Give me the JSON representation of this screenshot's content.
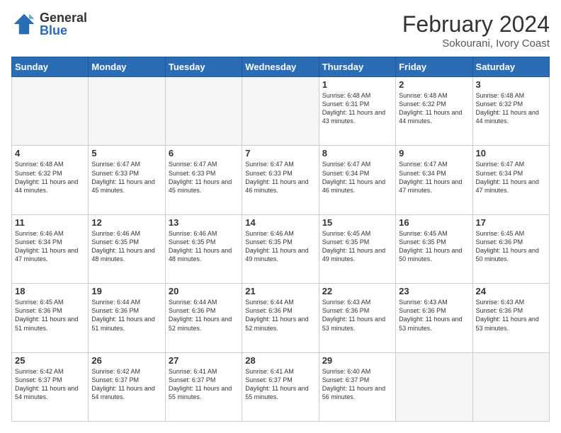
{
  "header": {
    "logo_general": "General",
    "logo_blue": "Blue",
    "month_year": "February 2024",
    "location": "Sokourani, Ivory Coast"
  },
  "days_of_week": [
    "Sunday",
    "Monday",
    "Tuesday",
    "Wednesday",
    "Thursday",
    "Friday",
    "Saturday"
  ],
  "weeks": [
    [
      {
        "day": "",
        "info": ""
      },
      {
        "day": "",
        "info": ""
      },
      {
        "day": "",
        "info": ""
      },
      {
        "day": "",
        "info": ""
      },
      {
        "day": "1",
        "info": "Sunrise: 6:48 AM\nSunset: 6:31 PM\nDaylight: 11 hours\nand 43 minutes."
      },
      {
        "day": "2",
        "info": "Sunrise: 6:48 AM\nSunset: 6:32 PM\nDaylight: 11 hours\nand 44 minutes."
      },
      {
        "day": "3",
        "info": "Sunrise: 6:48 AM\nSunset: 6:32 PM\nDaylight: 11 hours\nand 44 minutes."
      }
    ],
    [
      {
        "day": "4",
        "info": "Sunrise: 6:48 AM\nSunset: 6:32 PM\nDaylight: 11 hours\nand 44 minutes."
      },
      {
        "day": "5",
        "info": "Sunrise: 6:47 AM\nSunset: 6:33 PM\nDaylight: 11 hours\nand 45 minutes."
      },
      {
        "day": "6",
        "info": "Sunrise: 6:47 AM\nSunset: 6:33 PM\nDaylight: 11 hours\nand 45 minutes."
      },
      {
        "day": "7",
        "info": "Sunrise: 6:47 AM\nSunset: 6:33 PM\nDaylight: 11 hours\nand 46 minutes."
      },
      {
        "day": "8",
        "info": "Sunrise: 6:47 AM\nSunset: 6:34 PM\nDaylight: 11 hours\nand 46 minutes."
      },
      {
        "day": "9",
        "info": "Sunrise: 6:47 AM\nSunset: 6:34 PM\nDaylight: 11 hours\nand 47 minutes."
      },
      {
        "day": "10",
        "info": "Sunrise: 6:47 AM\nSunset: 6:34 PM\nDaylight: 11 hours\nand 47 minutes."
      }
    ],
    [
      {
        "day": "11",
        "info": "Sunrise: 6:46 AM\nSunset: 6:34 PM\nDaylight: 11 hours\nand 47 minutes."
      },
      {
        "day": "12",
        "info": "Sunrise: 6:46 AM\nSunset: 6:35 PM\nDaylight: 11 hours\nand 48 minutes."
      },
      {
        "day": "13",
        "info": "Sunrise: 6:46 AM\nSunset: 6:35 PM\nDaylight: 11 hours\nand 48 minutes."
      },
      {
        "day": "14",
        "info": "Sunrise: 6:46 AM\nSunset: 6:35 PM\nDaylight: 11 hours\nand 49 minutes."
      },
      {
        "day": "15",
        "info": "Sunrise: 6:45 AM\nSunset: 6:35 PM\nDaylight: 11 hours\nand 49 minutes."
      },
      {
        "day": "16",
        "info": "Sunrise: 6:45 AM\nSunset: 6:35 PM\nDaylight: 11 hours\nand 50 minutes."
      },
      {
        "day": "17",
        "info": "Sunrise: 6:45 AM\nSunset: 6:36 PM\nDaylight: 11 hours\nand 50 minutes."
      }
    ],
    [
      {
        "day": "18",
        "info": "Sunrise: 6:45 AM\nSunset: 6:36 PM\nDaylight: 11 hours\nand 51 minutes."
      },
      {
        "day": "19",
        "info": "Sunrise: 6:44 AM\nSunset: 6:36 PM\nDaylight: 11 hours\nand 51 minutes."
      },
      {
        "day": "20",
        "info": "Sunrise: 6:44 AM\nSunset: 6:36 PM\nDaylight: 11 hours\nand 52 minutes."
      },
      {
        "day": "21",
        "info": "Sunrise: 6:44 AM\nSunset: 6:36 PM\nDaylight: 11 hours\nand 52 minutes."
      },
      {
        "day": "22",
        "info": "Sunrise: 6:43 AM\nSunset: 6:36 PM\nDaylight: 11 hours\nand 53 minutes."
      },
      {
        "day": "23",
        "info": "Sunrise: 6:43 AM\nSunset: 6:36 PM\nDaylight: 11 hours\nand 53 minutes."
      },
      {
        "day": "24",
        "info": "Sunrise: 6:43 AM\nSunset: 6:36 PM\nDaylight: 11 hours\nand 53 minutes."
      }
    ],
    [
      {
        "day": "25",
        "info": "Sunrise: 6:42 AM\nSunset: 6:37 PM\nDaylight: 11 hours\nand 54 minutes."
      },
      {
        "day": "26",
        "info": "Sunrise: 6:42 AM\nSunset: 6:37 PM\nDaylight: 11 hours\nand 54 minutes."
      },
      {
        "day": "27",
        "info": "Sunrise: 6:41 AM\nSunset: 6:37 PM\nDaylight: 11 hours\nand 55 minutes."
      },
      {
        "day": "28",
        "info": "Sunrise: 6:41 AM\nSunset: 6:37 PM\nDaylight: 11 hours\nand 55 minutes."
      },
      {
        "day": "29",
        "info": "Sunrise: 6:40 AM\nSunset: 6:37 PM\nDaylight: 11 hours\nand 56 minutes."
      },
      {
        "day": "",
        "info": ""
      },
      {
        "day": "",
        "info": ""
      }
    ]
  ]
}
